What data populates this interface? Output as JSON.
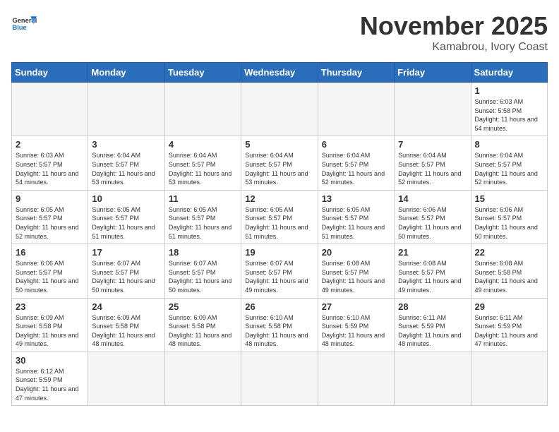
{
  "header": {
    "logo_general": "General",
    "logo_blue": "Blue",
    "month_title": "November 2025",
    "location": "Kamabrou, Ivory Coast"
  },
  "weekdays": [
    "Sunday",
    "Monday",
    "Tuesday",
    "Wednesday",
    "Thursday",
    "Friday",
    "Saturday"
  ],
  "weeks": [
    [
      {
        "day": "",
        "sunrise": "",
        "sunset": "",
        "daylight": "",
        "empty": true
      },
      {
        "day": "",
        "sunrise": "",
        "sunset": "",
        "daylight": "",
        "empty": true
      },
      {
        "day": "",
        "sunrise": "",
        "sunset": "",
        "daylight": "",
        "empty": true
      },
      {
        "day": "",
        "sunrise": "",
        "sunset": "",
        "daylight": "",
        "empty": true
      },
      {
        "day": "",
        "sunrise": "",
        "sunset": "",
        "daylight": "",
        "empty": true
      },
      {
        "day": "",
        "sunrise": "",
        "sunset": "",
        "daylight": "",
        "empty": true
      },
      {
        "day": "1",
        "sunrise": "Sunrise: 6:03 AM",
        "sunset": "Sunset: 5:58 PM",
        "daylight": "Daylight: 11 hours and 54 minutes.",
        "empty": false
      }
    ],
    [
      {
        "day": "2",
        "sunrise": "Sunrise: 6:03 AM",
        "sunset": "Sunset: 5:57 PM",
        "daylight": "Daylight: 11 hours and 54 minutes.",
        "empty": false
      },
      {
        "day": "3",
        "sunrise": "Sunrise: 6:04 AM",
        "sunset": "Sunset: 5:57 PM",
        "daylight": "Daylight: 11 hours and 53 minutes.",
        "empty": false
      },
      {
        "day": "4",
        "sunrise": "Sunrise: 6:04 AM",
        "sunset": "Sunset: 5:57 PM",
        "daylight": "Daylight: 11 hours and 53 minutes.",
        "empty": false
      },
      {
        "day": "5",
        "sunrise": "Sunrise: 6:04 AM",
        "sunset": "Sunset: 5:57 PM",
        "daylight": "Daylight: 11 hours and 53 minutes.",
        "empty": false
      },
      {
        "day": "6",
        "sunrise": "Sunrise: 6:04 AM",
        "sunset": "Sunset: 5:57 PM",
        "daylight": "Daylight: 11 hours and 52 minutes.",
        "empty": false
      },
      {
        "day": "7",
        "sunrise": "Sunrise: 6:04 AM",
        "sunset": "Sunset: 5:57 PM",
        "daylight": "Daylight: 11 hours and 52 minutes.",
        "empty": false
      },
      {
        "day": "8",
        "sunrise": "Sunrise: 6:04 AM",
        "sunset": "Sunset: 5:57 PM",
        "daylight": "Daylight: 11 hours and 52 minutes.",
        "empty": false
      }
    ],
    [
      {
        "day": "9",
        "sunrise": "Sunrise: 6:05 AM",
        "sunset": "Sunset: 5:57 PM",
        "daylight": "Daylight: 11 hours and 52 minutes.",
        "empty": false
      },
      {
        "day": "10",
        "sunrise": "Sunrise: 6:05 AM",
        "sunset": "Sunset: 5:57 PM",
        "daylight": "Daylight: 11 hours and 51 minutes.",
        "empty": false
      },
      {
        "day": "11",
        "sunrise": "Sunrise: 6:05 AM",
        "sunset": "Sunset: 5:57 PM",
        "daylight": "Daylight: 11 hours and 51 minutes.",
        "empty": false
      },
      {
        "day": "12",
        "sunrise": "Sunrise: 6:05 AM",
        "sunset": "Sunset: 5:57 PM",
        "daylight": "Daylight: 11 hours and 51 minutes.",
        "empty": false
      },
      {
        "day": "13",
        "sunrise": "Sunrise: 6:05 AM",
        "sunset": "Sunset: 5:57 PM",
        "daylight": "Daylight: 11 hours and 51 minutes.",
        "empty": false
      },
      {
        "day": "14",
        "sunrise": "Sunrise: 6:06 AM",
        "sunset": "Sunset: 5:57 PM",
        "daylight": "Daylight: 11 hours and 50 minutes.",
        "empty": false
      },
      {
        "day": "15",
        "sunrise": "Sunrise: 6:06 AM",
        "sunset": "Sunset: 5:57 PM",
        "daylight": "Daylight: 11 hours and 50 minutes.",
        "empty": false
      }
    ],
    [
      {
        "day": "16",
        "sunrise": "Sunrise: 6:06 AM",
        "sunset": "Sunset: 5:57 PM",
        "daylight": "Daylight: 11 hours and 50 minutes.",
        "empty": false
      },
      {
        "day": "17",
        "sunrise": "Sunrise: 6:07 AM",
        "sunset": "Sunset: 5:57 PM",
        "daylight": "Daylight: 11 hours and 50 minutes.",
        "empty": false
      },
      {
        "day": "18",
        "sunrise": "Sunrise: 6:07 AM",
        "sunset": "Sunset: 5:57 PM",
        "daylight": "Daylight: 11 hours and 50 minutes.",
        "empty": false
      },
      {
        "day": "19",
        "sunrise": "Sunrise: 6:07 AM",
        "sunset": "Sunset: 5:57 PM",
        "daylight": "Daylight: 11 hours and 49 minutes.",
        "empty": false
      },
      {
        "day": "20",
        "sunrise": "Sunrise: 6:08 AM",
        "sunset": "Sunset: 5:57 PM",
        "daylight": "Daylight: 11 hours and 49 minutes.",
        "empty": false
      },
      {
        "day": "21",
        "sunrise": "Sunrise: 6:08 AM",
        "sunset": "Sunset: 5:57 PM",
        "daylight": "Daylight: 11 hours and 49 minutes.",
        "empty": false
      },
      {
        "day": "22",
        "sunrise": "Sunrise: 6:08 AM",
        "sunset": "Sunset: 5:58 PM",
        "daylight": "Daylight: 11 hours and 49 minutes.",
        "empty": false
      }
    ],
    [
      {
        "day": "23",
        "sunrise": "Sunrise: 6:09 AM",
        "sunset": "Sunset: 5:58 PM",
        "daylight": "Daylight: 11 hours and 49 minutes.",
        "empty": false
      },
      {
        "day": "24",
        "sunrise": "Sunrise: 6:09 AM",
        "sunset": "Sunset: 5:58 PM",
        "daylight": "Daylight: 11 hours and 48 minutes.",
        "empty": false
      },
      {
        "day": "25",
        "sunrise": "Sunrise: 6:09 AM",
        "sunset": "Sunset: 5:58 PM",
        "daylight": "Daylight: 11 hours and 48 minutes.",
        "empty": false
      },
      {
        "day": "26",
        "sunrise": "Sunrise: 6:10 AM",
        "sunset": "Sunset: 5:58 PM",
        "daylight": "Daylight: 11 hours and 48 minutes.",
        "empty": false
      },
      {
        "day": "27",
        "sunrise": "Sunrise: 6:10 AM",
        "sunset": "Sunset: 5:59 PM",
        "daylight": "Daylight: 11 hours and 48 minutes.",
        "empty": false
      },
      {
        "day": "28",
        "sunrise": "Sunrise: 6:11 AM",
        "sunset": "Sunset: 5:59 PM",
        "daylight": "Daylight: 11 hours and 48 minutes.",
        "empty": false
      },
      {
        "day": "29",
        "sunrise": "Sunrise: 6:11 AM",
        "sunset": "Sunset: 5:59 PM",
        "daylight": "Daylight: 11 hours and 47 minutes.",
        "empty": false
      }
    ],
    [
      {
        "day": "30",
        "sunrise": "Sunrise: 6:12 AM",
        "sunset": "Sunset: 5:59 PM",
        "daylight": "Daylight: 11 hours and 47 minutes.",
        "empty": false
      },
      {
        "day": "",
        "sunrise": "",
        "sunset": "",
        "daylight": "",
        "empty": true
      },
      {
        "day": "",
        "sunrise": "",
        "sunset": "",
        "daylight": "",
        "empty": true
      },
      {
        "day": "",
        "sunrise": "",
        "sunset": "",
        "daylight": "",
        "empty": true
      },
      {
        "day": "",
        "sunrise": "",
        "sunset": "",
        "daylight": "",
        "empty": true
      },
      {
        "day": "",
        "sunrise": "",
        "sunset": "",
        "daylight": "",
        "empty": true
      },
      {
        "day": "",
        "sunrise": "",
        "sunset": "",
        "daylight": "",
        "empty": true
      }
    ]
  ]
}
